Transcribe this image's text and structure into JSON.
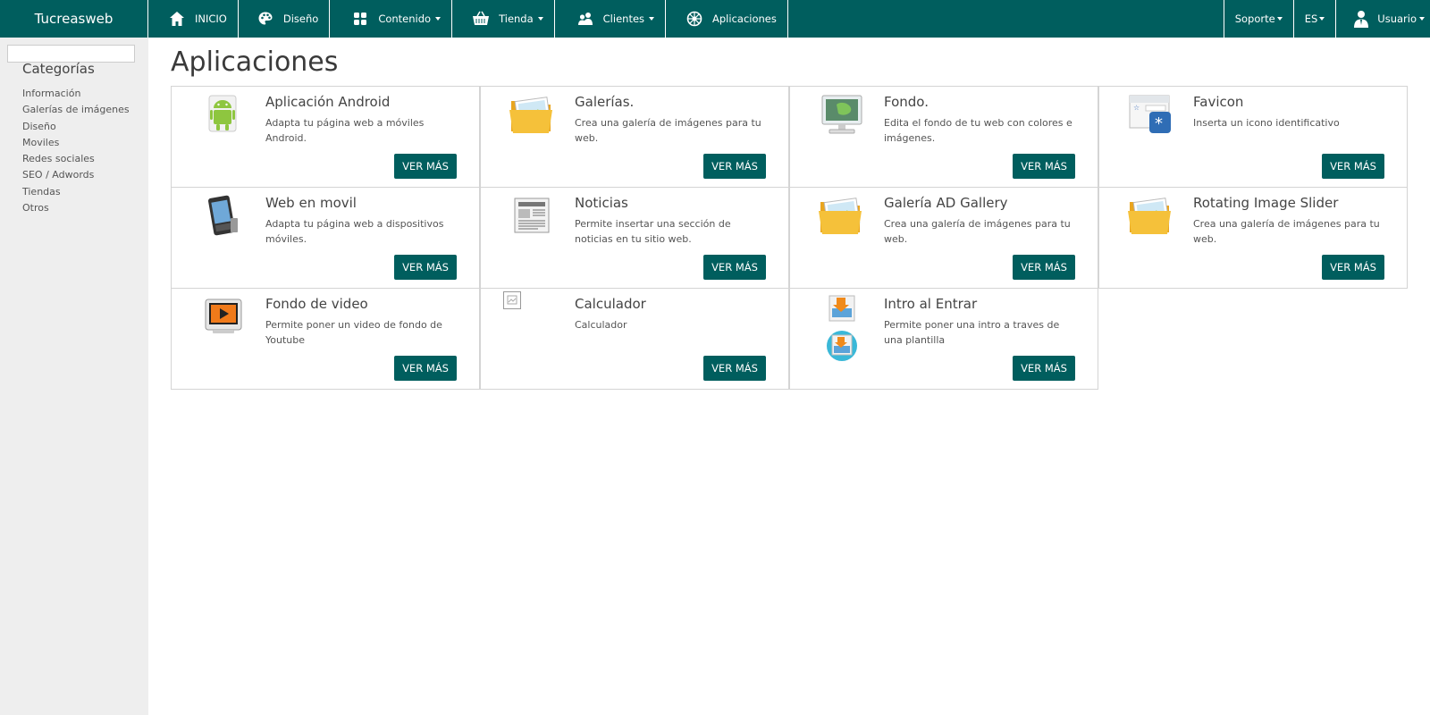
{
  "brand": "Tucreasweb",
  "nav": [
    {
      "label": "INICIO",
      "icon": "home-icon",
      "dropdown": false
    },
    {
      "label": "Diseño",
      "icon": "palette-icon",
      "dropdown": false
    },
    {
      "label": "Contenido",
      "icon": "grid-icon",
      "dropdown": true
    },
    {
      "label": "Tienda",
      "icon": "basket-icon",
      "dropdown": true
    },
    {
      "label": "Clientes",
      "icon": "users-icon",
      "dropdown": true
    },
    {
      "label": "Aplicaciones",
      "icon": "apps-icon",
      "dropdown": false
    }
  ],
  "nav_right": {
    "support": "Soporte",
    "language": "ES",
    "user": "Usuario"
  },
  "sidebar": {
    "search_value": "",
    "title": "Categorías",
    "items": [
      "Información",
      "Galerías de imágenes",
      "Diseño",
      "Moviles",
      "Redes sociales",
      "SEO / Adwords",
      "Tiendas",
      "Otros"
    ]
  },
  "page_title": "Aplicaciones",
  "button_label": "VER MÁS",
  "cards": [
    {
      "title": "Aplicación Android",
      "desc": "Adapta tu página web a móviles Android.",
      "icon": "android-icon"
    },
    {
      "title": "Galerías.",
      "desc": "Crea una galería de imágenes para tu web.",
      "icon": "gallery-folder-icon"
    },
    {
      "title": "Fondo.",
      "desc": "Edita el fondo de tu web con colores e imágenes.",
      "icon": "background-monitor-icon"
    },
    {
      "title": "Favicon",
      "desc": "Inserta un icono identificativo",
      "icon": "favicon-icon"
    },
    {
      "title": "Web en movil",
      "desc": "Adapta tu página web a dispositivos móviles.",
      "icon": "mobile-phone-icon"
    },
    {
      "title": "Noticias",
      "desc": "Permite insertar una sección de noticias en tu sitio web.",
      "icon": "newspaper-icon"
    },
    {
      "title": "Galería AD Gallery",
      "desc": "Crea una galería de imágenes para tu web.",
      "icon": "gallery-folder-icon"
    },
    {
      "title": "Rotating Image Slider",
      "desc": "Crea una galería de imágenes para tu web.",
      "icon": "gallery-folder-icon"
    },
    {
      "title": "Fondo de video",
      "desc": "Permite poner un video de fondo de Youtube",
      "icon": "video-icon"
    },
    {
      "title": "Calculador",
      "desc": "Calculador",
      "icon": "broken-image-icon"
    },
    {
      "title": "Intro al Entrar",
      "desc": "Permite poner una intro a traves de una plantilla",
      "icon": "intro-icon"
    }
  ],
  "colors": {
    "primary": "#005e5e",
    "sidebar_bg": "#eeeeee"
  }
}
